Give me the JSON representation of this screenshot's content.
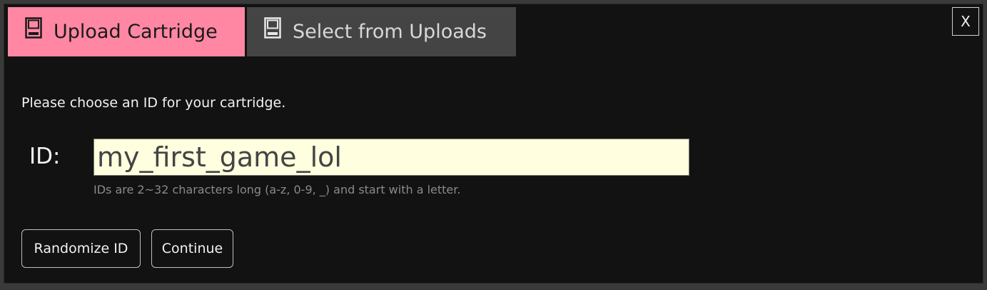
{
  "tabs": [
    {
      "label": "Upload Cartridge",
      "icon": "cartridge-icon",
      "active": true
    },
    {
      "label": "Select from Uploads",
      "icon": "cartridge-icon",
      "active": false
    }
  ],
  "close_label": "X",
  "prompt": "Please choose an ID for your cartridge.",
  "id_field": {
    "label": "ID:",
    "value": "my_first_game_lol"
  },
  "hint": "IDs are 2~32 characters long (a-z, 0-9, _) and start with a letter.",
  "buttons": {
    "randomize": "Randomize ID",
    "continue": "Continue"
  },
  "colors": {
    "active_tab": "#ff87a3",
    "inactive_tab": "#444444",
    "background": "#121212",
    "input_bg": "#ffffdf"
  }
}
